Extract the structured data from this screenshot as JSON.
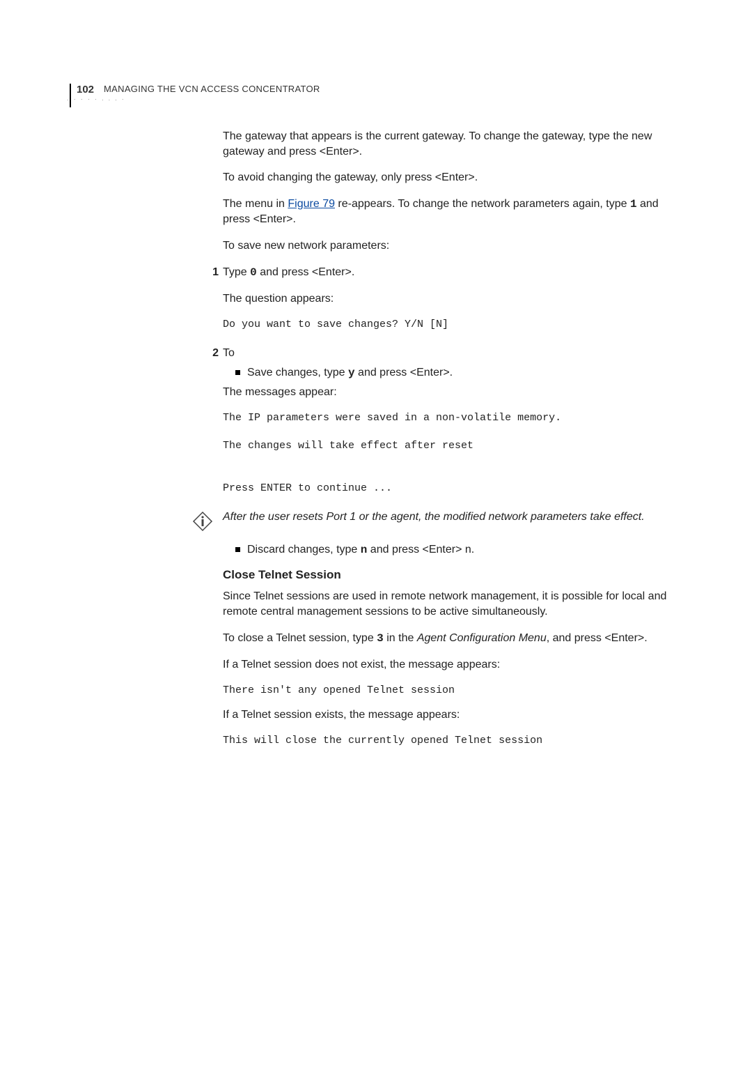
{
  "header": {
    "page_number": "102",
    "running_head_prefix": "M",
    "running_head_rest": "ANAGING THE VCN ACCESS CONCENTRATOR"
  },
  "body": {
    "p_gateway_intro": "The gateway that appears is the current gateway. To change the gateway, type the new gateway and press <Enter>.",
    "p_avoid_change": "To avoid changing the gateway, only press <Enter>.",
    "p_menu_pre": "The menu in ",
    "link_figure": "Figure 79",
    "p_menu_post_1": " re-appears. To change the network parameters again, type ",
    "key_1": "1",
    "p_menu_post_2": " and press <Enter>.",
    "p_save_intro": "To save new network parameters:",
    "step1_pre": "Type ",
    "step1_key": "0",
    "step1_post": " and press <Enter>.",
    "step1_question_label": "The question appears:",
    "step1_code": "Do you want to save changes? Y/N [N]",
    "step2_text": "To",
    "step2_bullet_pre": "Save changes, type ",
    "step2_bullet_key": "y",
    "step2_bullet_post": " and press <Enter>.",
    "step2_messages_label": "The messages appear:",
    "step2_code": "The IP parameters were saved in a non-volatile memory.\n\nThe changes will take effect after reset\n\n\nPress ENTER to continue ...",
    "note_text": "After the user resets Port 1 or the agent, the modified network parameters take effect.",
    "discard_pre": "Discard changes, type ",
    "discard_key": "n",
    "discard_post": " and press <Enter> n.",
    "close_telnet_heading": "Close Telnet Session",
    "close_telnet_p1": "Since Telnet sessions are used in remote network management, it is possible for local and remote central management sessions to be active simultaneously.",
    "close_telnet_p2_pre": "To close a Telnet session, type ",
    "close_telnet_p2_key": "3",
    "close_telnet_p2_mid": " in the ",
    "close_telnet_p2_italic": "Agent Configuration Menu",
    "close_telnet_p2_post": ", and press <Enter>.",
    "close_telnet_noexist": "If a Telnet session does not exist, the message appears:",
    "close_telnet_noexist_code": "There isn't any opened Telnet session",
    "close_telnet_exist": "If a Telnet session exists, the message appears:",
    "close_telnet_exist_code": "This will close the currently opened Telnet session"
  }
}
